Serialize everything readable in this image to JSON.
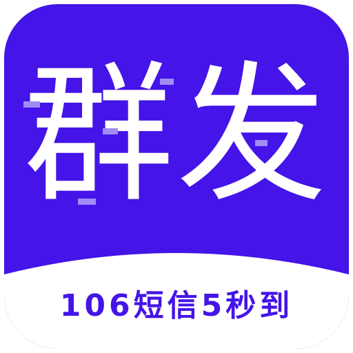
{
  "app_icon": {
    "title": "群发",
    "tagline": "106短信5秒到",
    "colors": {
      "background": "#4414e8",
      "title_text": "#ffffff",
      "band": "#ffffff",
      "tagline_text": "#4414e8",
      "accent_marks": "#a08cf5"
    }
  }
}
